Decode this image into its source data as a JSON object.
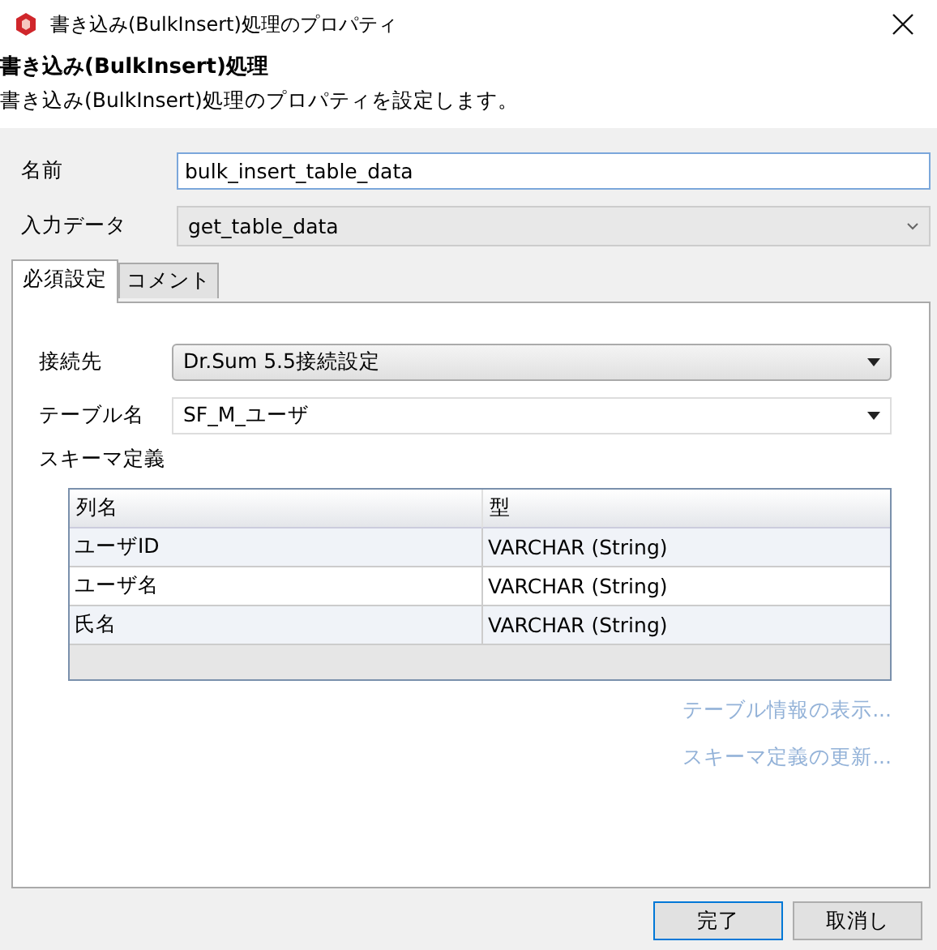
{
  "window": {
    "title": "書き込み(BulkInsert)処理のプロパティ"
  },
  "header": {
    "title": "書き込み(BulkInsert)処理",
    "description": "書き込み(BulkInsert)処理のプロパティを設定します。"
  },
  "fields": [
    {
      "kind": "text",
      "label": "名前",
      "value": "bulk_insert_table_data",
      "focused": true
    },
    {
      "kind": "combo",
      "label": "入力データ",
      "value": "get_table_data",
      "focused": false
    }
  ],
  "tabs": [
    {
      "label": "必須設定",
      "selected": true
    },
    {
      "label": "コメント",
      "selected": false
    }
  ],
  "settings": [
    {
      "kind": "button-select",
      "label": "接続先",
      "value": "Dr.Sum 5.5接続設定"
    },
    {
      "kind": "select",
      "label": "テーブル名",
      "value": "SF_M_ユーザ"
    }
  ],
  "schema": {
    "label": "スキーマ定義",
    "columns": [
      "列名",
      "型"
    ],
    "rows": [
      [
        "ユーザID",
        "VARCHAR (String)"
      ],
      [
        "ユーザ名",
        "VARCHAR (String)"
      ],
      [
        "氏名",
        "VARCHAR (String)"
      ]
    ]
  },
  "links": [
    {
      "label": "テーブル情報の表示...",
      "disabled": true
    },
    {
      "label": "スキーマ定義の更新...",
      "disabled": true
    }
  ],
  "buttons": [
    {
      "label": "完了",
      "default": true
    },
    {
      "label": "取消し",
      "default": false
    }
  ]
}
